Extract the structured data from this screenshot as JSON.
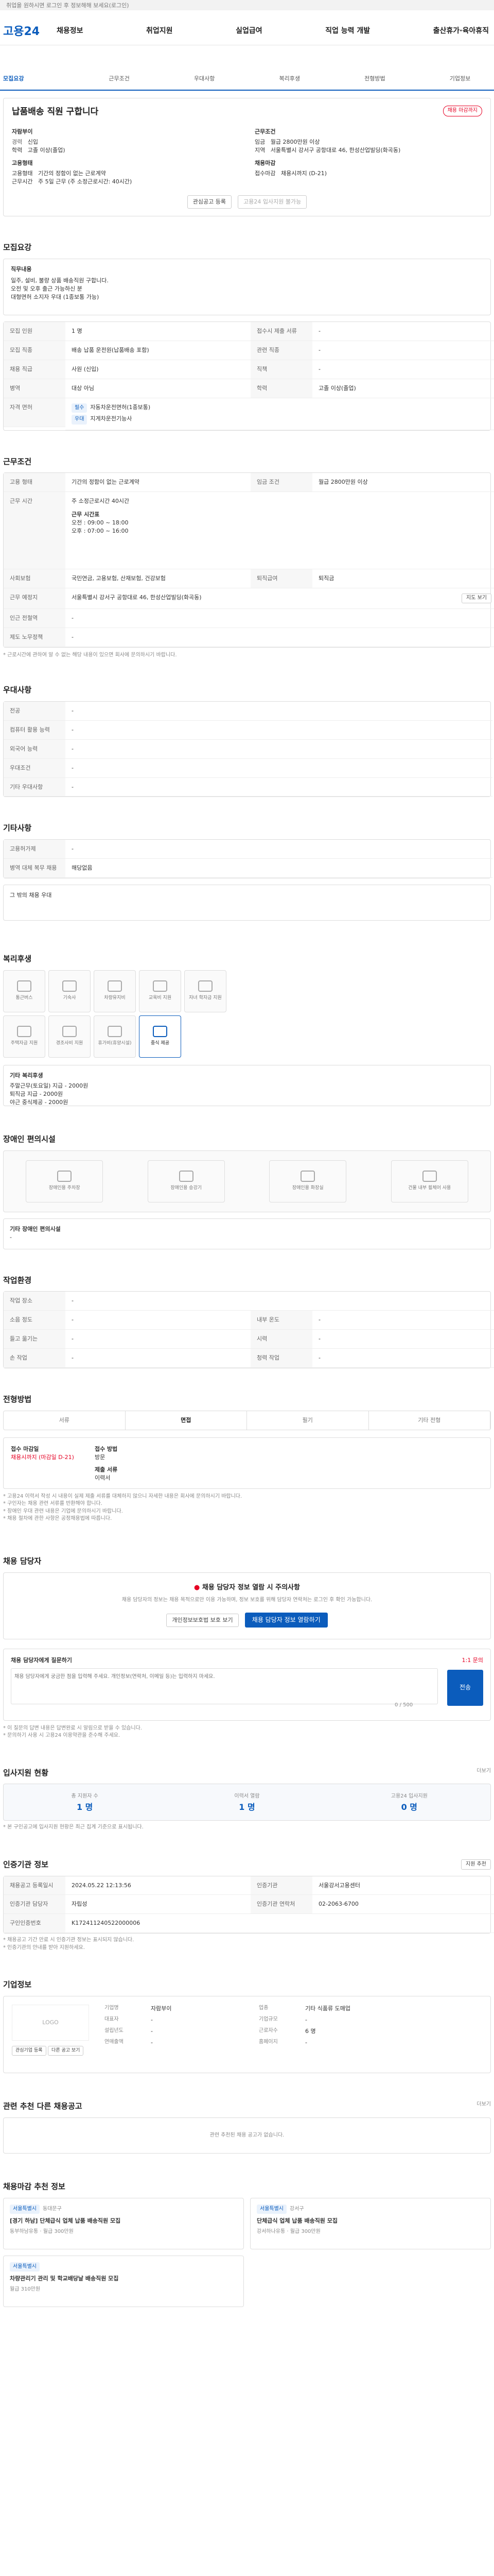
{
  "topbar": {
    "text": "취업을 원하시면 로그인 후 정보해해 보세요(로그인)"
  },
  "header": {
    "logo": "고용24",
    "nav": [
      "채용정보",
      "취업지원",
      "실업급여",
      "직업 능력 개발",
      "출산휴가·육아휴직"
    ]
  },
  "tabs": [
    "모집요강",
    "근무조건",
    "우대사항",
    "복리후생",
    "전형방법",
    "기업정보"
  ],
  "job": {
    "badge": "채용 마감까지",
    "title": "납품배송 직원 구합니다",
    "company_label": "자람부이",
    "left": [
      [
        "경력",
        "신입"
      ],
      [
        "학력",
        "고졸 이상(졸업)"
      ]
    ],
    "right_label": "근무조건",
    "right": [
      [
        "임금",
        "월급 2800만원 이상"
      ],
      [
        "지역",
        "서울특별시 강서구 공항대로 46, 한성산업빌딩(화곡동)"
      ]
    ],
    "left2_label": "고용형태",
    "left2": [
      [
        "고용형태",
        "기간의 정함이 없는 근로계약"
      ],
      [
        "근무시간",
        "주 5일 근무 (주 소정근로시간: 40시간)"
      ]
    ],
    "right2_label": "채용마감",
    "right2": [
      [
        "접수마감",
        "채용시까지 (D-21)"
      ]
    ],
    "btn_interest": "관심공고 등록",
    "btn_apply": "고용24 입사지원 불가능"
  },
  "recruit": {
    "title": "모집요강",
    "desc_label": "직무내용",
    "desc": [
      "일주, 설비, 불량 상품 배송직원 구합니다.",
      "오전 및 오후 출근 가능하신 분",
      "대형면허 소지자 우대 (1종보통 가능)"
    ],
    "rows": [
      [
        "모집 인원",
        "1 명",
        "접수시 제출 서류",
        "-"
      ],
      [
        "모집 직종",
        "배송 납품 운전원(납품배송 포함)",
        "관련 직종",
        "-"
      ],
      [
        "채용 직급",
        "사원 (신입)",
        "직책",
        "-"
      ],
      [
        "병역",
        "대상 아님",
        "학력",
        "고졸 이상(졸업)"
      ]
    ],
    "license_label": "자격 면허",
    "license": [
      [
        "필수",
        "자동차운전면허(1종보통)"
      ],
      [
        "우대",
        "지게차운전기능사"
      ]
    ]
  },
  "conditions": {
    "title": "근무조건",
    "rows": [
      [
        "고용 형태",
        "기간의 정함이 없는 근로계약",
        "임금 조건",
        "월급 2800만원 이상"
      ],
      [
        "근무 시간",
        "주 소정근로시간 40시간",
        "근무 형태",
        "주 5일 근무"
      ],
      [
        "사회보험",
        "국민연금, 고용보험, 산재보험, 건강보험",
        "퇴직급여",
        "퇴직금"
      ],
      [
        "근무 예정지",
        "서울특별시 강서구 공항대로 46, 한성산업빌딩(화곡동)",
        "",
        ""
      ],
      [
        "인근 전철역",
        "-",
        "",
        ""
      ],
      [
        "제도 노무정책",
        "-",
        "",
        ""
      ]
    ],
    "time": [
      "주 소정근로시간 40시간",
      "근무 시간표",
      "오전 : 09:00 ~ 18:00",
      "오후 : 07:00 ~ 16:00"
    ],
    "map_btn": "지도 보기",
    "note": "* 근로시간에 관하여 알 수 없는 해당 내용이 있으면 회사에 문의하시기 바랍니다."
  },
  "prefer": {
    "title": "우대사항",
    "rows": [
      [
        "전공",
        "-"
      ],
      [
        "컴퓨터 활용 능력",
        "-"
      ],
      [
        "외국어 능력",
        "-"
      ],
      [
        "우대조건",
        "-"
      ],
      [
        "기타 우대사항",
        "-"
      ]
    ]
  },
  "other": {
    "title": "기타사항",
    "rows": [
      [
        "고용허가제",
        "-"
      ],
      [
        "병역 대체 복무 채용",
        "해당없음"
      ]
    ],
    "more": "그 밖의 채용 우대"
  },
  "welfare": {
    "title": "복리후생",
    "tiles": [
      "통근버스",
      "기숙사",
      "차량유지비",
      "교육비 지원",
      "자녀 학자금 지원",
      "주택자금 지원",
      "경조사비 지원",
      "휴가비(휴양시설)",
      "중식 제공"
    ],
    "other_label": "기타 복리후생",
    "other": [
      "주말근무(토요일) 지급 - 2000원",
      "퇴직금 지급 - 2000원",
      "야근 중식제공 - 2000원"
    ]
  },
  "disability": {
    "title": "장애인 편의시설",
    "tiles": [
      "장애인용 주차장",
      "장애인용 승강기",
      "장애인용 화장실",
      "건물 내부 휠체어 사용"
    ],
    "other_label": "기타 장애인 편의시설",
    "other": "-"
  },
  "env": {
    "title": "작업환경",
    "rows": [
      [
        "작업 장소",
        "-",
        "",
        ""
      ],
      [
        "소음 정도",
        "-",
        "내부 온도",
        "-"
      ],
      [
        "들고 옮기는",
        "-",
        "시력",
        "-"
      ],
      [
        "손 작업",
        "-",
        "청력 작업",
        "-"
      ]
    ]
  },
  "selection": {
    "title": "전형방법",
    "steps": [
      "서류",
      "면접",
      "필기",
      "기타 전형"
    ],
    "active": 1,
    "c1_label": "접수 마감일",
    "c1": "채용시까지 (마감일 D-21)",
    "c2_label": "접수 방법",
    "c2": "방문",
    "c3_label": "제출 서류",
    "c3": "이력서",
    "notes": [
      "* 고용24 이력서 작성 시 내용이 실제 제출 서류를 대체하지 않으니 자세한 내용은 회사에 문의하시기 바랍니다.",
      "* 구인자는 채용 관련 서류를 반환해야 합니다.",
      "* 장애인 우대 관련 내용은 기업에 문의하시기 바랍니다.",
      "* 채용 절차에 관한 사항은 공정채용법에 따릅니다."
    ]
  },
  "contact": {
    "title": "채용 담당자",
    "warn": "채용 담당자 정보 열람 시 주의사항",
    "warn_desc": "채용 담당자의 정보는 채용 목적으로만 이용 가능하며, 정보 보호를 위해 담당자 연락처는 로그인 후 확인 가능합니다.",
    "btn1": "개인정보보호법 보호 보기",
    "btn2": "채용 담당자 정보 열람하기",
    "q_label": "채용 담당자에게 질문하기",
    "q_hint": "1:1 문의",
    "q_placeholder": "채용 담당자에게 궁금한 점을 입력해 주세요. 개인정보(연락처, 이메일 등)는 입력하지 마세요.",
    "q_count": "0 / 500",
    "q_btn": "전송",
    "notes": [
      "* 이 질문의 답변 내용은 답변완료 시 알림으로 받을 수 있습니다.",
      "* 문의하기 사용 시 고용24 이용약관을 준수해 주세요."
    ]
  },
  "applicants": {
    "title": "입사지원 현황",
    "link": "더보기",
    "stats": [
      [
        "총 지원자 수",
        "1 명"
      ],
      [
        "이력서 열람",
        "1 명"
      ],
      [
        "고용24 입사지원",
        "0 명"
      ]
    ],
    "note": "* 본 구인공고에 입사지원 현황은 최근 집계 기준으로 표시됩니다."
  },
  "info": {
    "title": "인증기관 정보",
    "link": "지원 추천",
    "rows": [
      [
        "채용공고 등록일시",
        "2024.05.22 12:13:56",
        "인증기관",
        "서울강서고용센터"
      ],
      [
        "인증기관 담당자",
        "자립성",
        "인증기관 연락처",
        "02-2063-6700"
      ],
      [
        "구인인증번호",
        "K172411240522000006",
        "",
        ""
      ]
    ],
    "notes": [
      "* 채용공고 기간 만료 시 인증기관 정보는 표시되지 않습니다.",
      "* 인증기관의 안내를 받아 지원하세요."
    ]
  },
  "company": {
    "title": "기업정보",
    "logo": "LOGO",
    "cols": [
      [
        "기업명",
        "자람부이"
      ],
      [
        "업종",
        "기타 식품류 도매업"
      ],
      [
        "대표자",
        "-"
      ],
      [
        "기업규모",
        "-"
      ],
      [
        "설립년도",
        "-"
      ],
      [
        "근로자수",
        "6 명"
      ],
      [
        "연매출액",
        "-"
      ],
      [
        "홈페이지",
        "-"
      ]
    ],
    "btns": [
      "관심기업 등록",
      "다른 공고 보기"
    ]
  },
  "similar": {
    "title": "관련 추천 다른 채용공고",
    "link": "더보기",
    "empty": "관련 추천된 채용 공고가 없습니다."
  },
  "recommend": {
    "title": "채용마감 추천 정보",
    "cards": [
      {
        "tag": "서울특별시",
        "loc": "동대문구",
        "title": "[경기 하남] 단체급식 업체 납품 배송직원 모집",
        "co": "동부하남유통",
        "pay": "월급 300만원"
      },
      {
        "tag": "서울특별시",
        "loc": "강서구",
        "title": "단체급식 업체 납품 배송직원 모집",
        "co": "강서하나유통",
        "pay": "월급 300만원"
      },
      {
        "tag": "서울특별시",
        "loc": "",
        "title": "차량관리기 관리 및 학교배당날 배송직원 모집",
        "co": "",
        "pay": "월급 310만원"
      }
    ]
  }
}
